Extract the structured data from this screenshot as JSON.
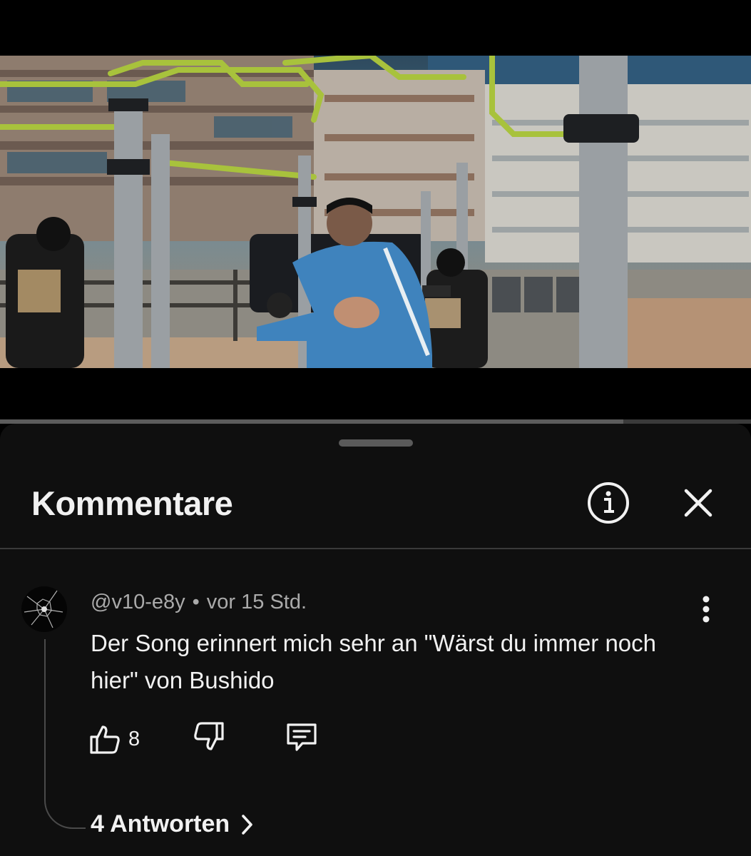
{
  "video": {
    "thumbnail_icon": "music-video-frame",
    "progress_percent": 74.5,
    "buffered_percent": 83
  },
  "comments_sheet": {
    "title": "Kommentare",
    "info_icon": "info-icon",
    "close_icon": "close-icon"
  },
  "comment": {
    "author": "@v10-e8y",
    "separator": "•",
    "timestamp": "vor 15 Std.",
    "text": "Der Song erinnert mich sehr an \"Wärst du immer noch hier\" von Bushido",
    "like_count": "8",
    "replies_label": "4 Antworten",
    "icons": {
      "like": "thumbs-up-icon",
      "dislike": "thumbs-down-icon",
      "reply": "reply-icon",
      "more": "more-vertical-icon",
      "replies": "chevron-right-icon"
    }
  },
  "colors": {
    "sheet_background": "#0f0f0f",
    "primary_text": "#f1f1f1",
    "secondary_text": "#aaaaaa",
    "divider": "#3a3a3a"
  }
}
